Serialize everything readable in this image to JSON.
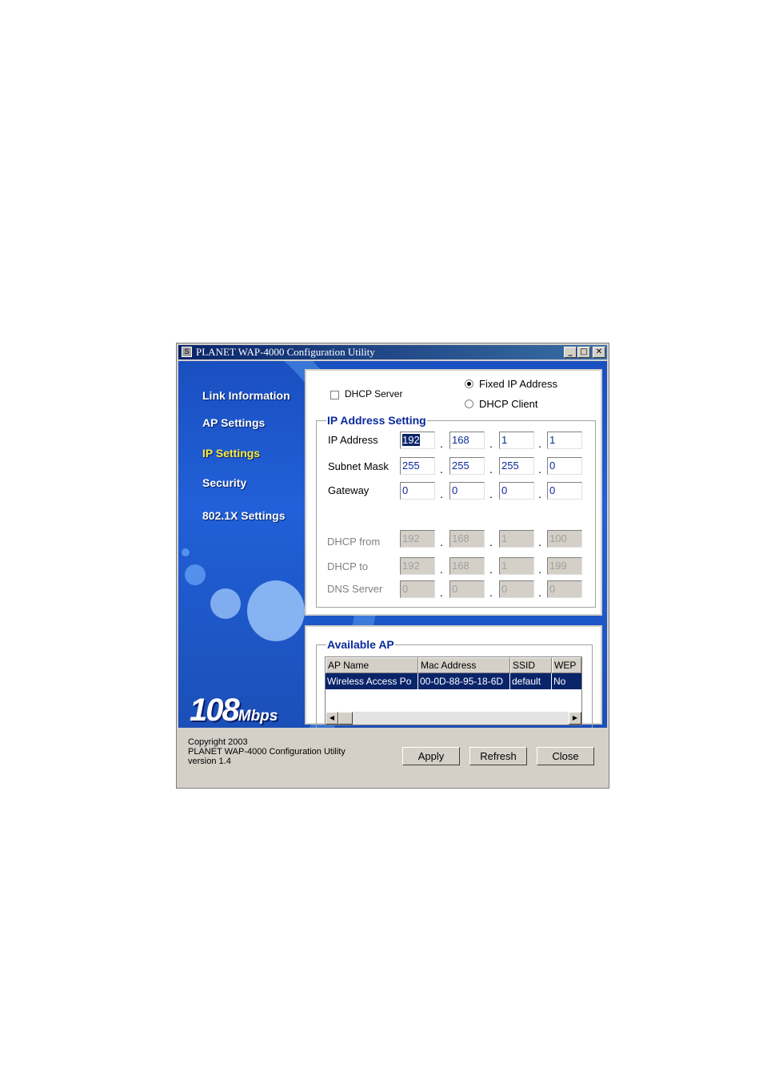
{
  "window": {
    "title": "PLANET WAP-4000 Configuration Utility",
    "app_icon": "S",
    "controls": {
      "minimize": "_",
      "maximize": "□",
      "close": "✕"
    }
  },
  "sidebar": {
    "items": [
      {
        "label": "Link Information"
      },
      {
        "label": "AP Settings"
      },
      {
        "label": "IP Settings"
      },
      {
        "label": "Security"
      },
      {
        "label": "802.1X Settings"
      }
    ],
    "active_color": "#ffea3a",
    "logo_big": "108",
    "logo_small": "Mbps"
  },
  "mode": {
    "dhcp_server": "DHCP Server",
    "fixed_ip": "Fixed IP Address",
    "dhcp_client": "DHCP Client",
    "selected": "Fixed IP Address"
  },
  "ip_setting": {
    "legend": "IP Address Setting",
    "ip_address": {
      "label": "IP Address",
      "octets": [
        "192",
        "168",
        "1",
        "1"
      ]
    },
    "subnet_mask": {
      "label": "Subnet Mask",
      "octets": [
        "255",
        "255",
        "255",
        "0"
      ]
    },
    "gateway": {
      "label": "Gateway",
      "octets": [
        "0",
        "0",
        "0",
        "0"
      ]
    },
    "dhcp_from": {
      "label": "DHCP from",
      "octets": [
        "192",
        "168",
        "1",
        "100"
      ]
    },
    "dhcp_to": {
      "label": "DHCP to",
      "octets": [
        "192",
        "168",
        "1",
        "199"
      ]
    },
    "dns_server": {
      "label": "DNS Server",
      "octets": [
        "0",
        "0",
        "0",
        "0"
      ]
    },
    "separator": "."
  },
  "available_ap": {
    "legend": "Available AP",
    "columns": [
      "AP Name",
      "Mac Address",
      "SSID",
      "WEP"
    ],
    "rows": [
      [
        "Wireless Access Po",
        "00-0D-88-95-18-6D",
        "default",
        "No"
      ]
    ],
    "scroll_left": "◀",
    "scroll_right": "▶"
  },
  "footer": {
    "copyright": "Copyright 2003",
    "product": "PLANET WAP-4000 Configuration Utility",
    "version": "version 1.4",
    "apply": "Apply",
    "refresh": "Refresh",
    "close": "Close"
  }
}
